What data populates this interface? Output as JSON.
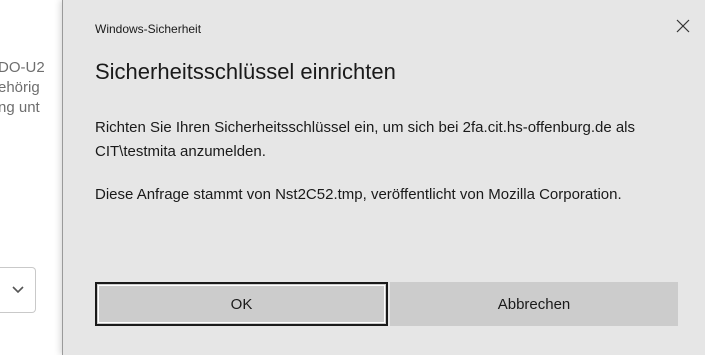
{
  "background": {
    "text_lines": [
      "DO-U2",
      "ehörig",
      "ng unt"
    ],
    "select_chevron": "chevron-down-icon"
  },
  "dialog": {
    "caption": "Windows-Sicherheit",
    "close_icon": "close-icon",
    "heading": "Sicherheitsschlüssel einrichten",
    "paragraph1": "Richten Sie Ihren Sicherheitsschlüssel ein, um sich bei 2fa.cit.hs-offenburg.de als CIT\\testmita anzumelden.",
    "paragraph2": "Diese Anfrage stammt von Nst2C52.tmp, veröffentlicht von Mozilla Corporation.",
    "ok_label": "OK",
    "cancel_label": "Abbrechen"
  },
  "colors": {
    "dialog_bg": "#e6e6e6",
    "button_bg": "#cccccc",
    "text": "#1a1a1a"
  }
}
